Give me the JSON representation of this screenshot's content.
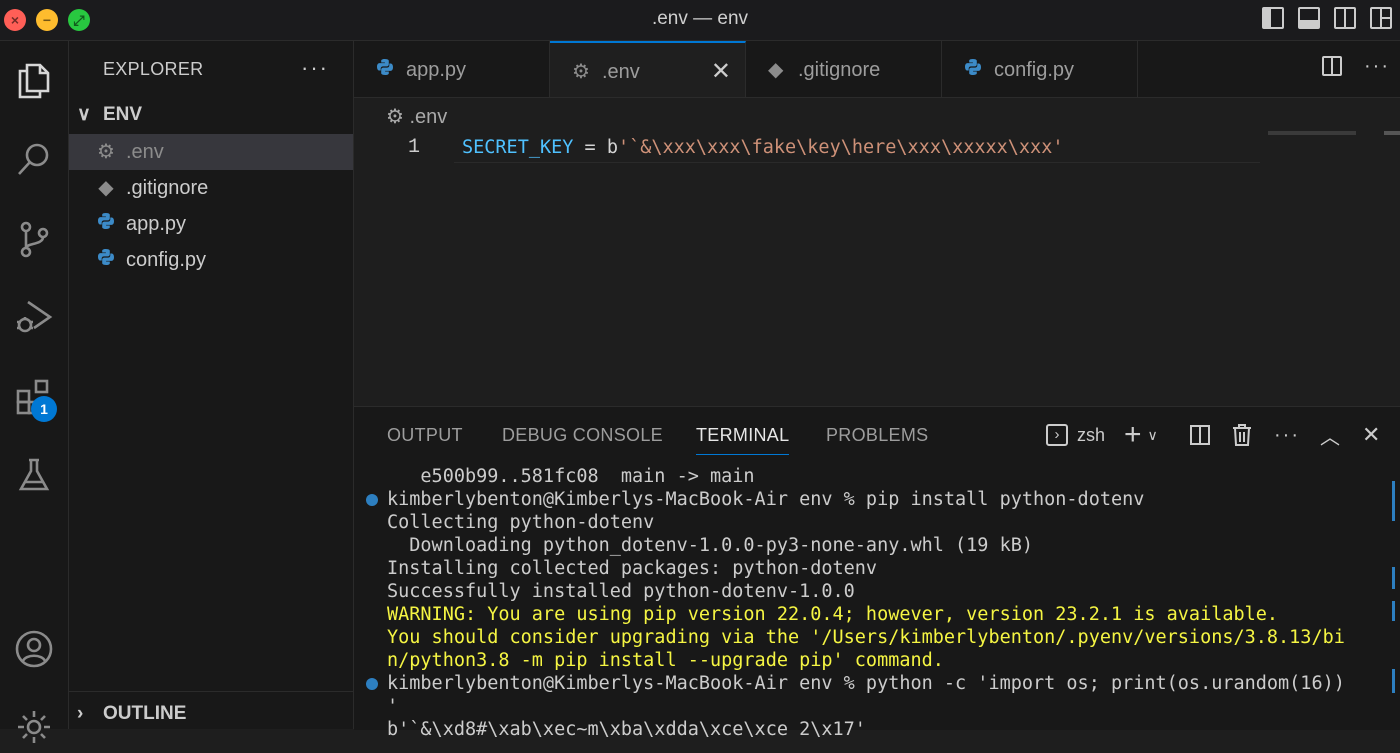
{
  "window": {
    "title": ".env — env"
  },
  "activity_bar": {
    "items": [
      "files-icon",
      "search-icon",
      "source-control-icon",
      "run-debug-icon",
      "extensions-icon",
      "testing-icon",
      "account-icon",
      "settings-gear-icon"
    ],
    "extensions_badge": "1"
  },
  "explorer": {
    "title": "EXPLORER",
    "more": "···",
    "folder": "ENV",
    "files": [
      {
        "name": ".env",
        "icon": "gear-icon",
        "active": true
      },
      {
        "name": ".gitignore",
        "icon": "git-icon",
        "active": false
      },
      {
        "name": "app.py",
        "icon": "python-icon",
        "active": false
      },
      {
        "name": "config.py",
        "icon": "python-icon",
        "active": false
      }
    ],
    "outline": "OUTLINE"
  },
  "tabs": [
    {
      "label": "app.py",
      "icon": "python-icon"
    },
    {
      "label": ".env",
      "icon": "gear-icon",
      "active": true
    },
    {
      "label": ".gitignore",
      "icon": "git-icon"
    },
    {
      "label": "config.py",
      "icon": "python-icon"
    }
  ],
  "editor": {
    "breadcrumb": ".env",
    "line_number": "1",
    "code": {
      "variable": "SECRET_KEY",
      "operator": " = ",
      "prefix": "b",
      "string": "'`&\\xxx\\xxx\\fake\\key\\here\\xxx\\xxxxx\\xxx'"
    }
  },
  "panel": {
    "tabs": [
      "OUTPUT",
      "DEBUG CONSOLE",
      "TERMINAL",
      "PROBLEMS"
    ],
    "active_tab": "TERMINAL",
    "shell": "zsh",
    "terminal_lines": [
      "   e500b99..581fc08  main -> main",
      "kimberlybenton@Kimberlys-MacBook-Air env % pip install python-dotenv",
      "Collecting python-dotenv",
      "  Downloading python_dotenv-1.0.0-py3-none-any.whl (19 kB)",
      "Installing collected packages: python-dotenv",
      "Successfully installed python-dotenv-1.0.0",
      "WARNING: You are using pip version 22.0.4; however, version 23.2.1 is available.",
      "You should consider upgrading via the '/Users/kimberlybenton/.pyenv/versions/3.8.13/bi",
      "n/python3.8 -m pip install --upgrade pip' command.",
      "kimberlybenton@Kimberlys-MacBook-Air env % python -c 'import os; print(os.urandom(16))",
      "'",
      "b'`&\\xd8#\\xab\\xec~m\\xba\\xdda\\xce\\xce 2\\x17'"
    ]
  }
}
